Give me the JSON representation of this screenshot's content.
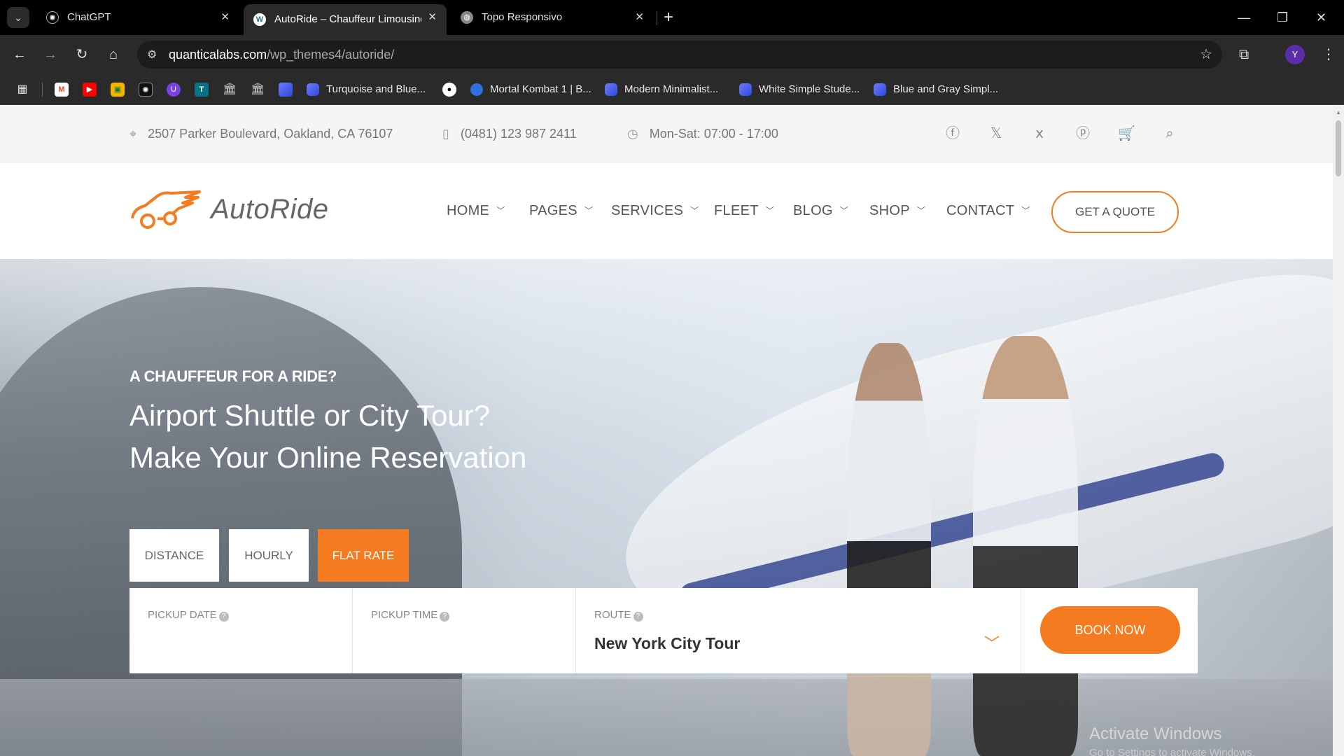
{
  "browser": {
    "tabs": [
      {
        "title": "ChatGPT",
        "icon": "chatgpt-icon"
      },
      {
        "title": "AutoRide – Chauffeur Limousine",
        "icon": "wordpress-icon"
      },
      {
        "title": "Topo Responsivo",
        "icon": "globe-icon"
      }
    ],
    "url_host": "quanticalabs.com",
    "url_path": "/wp_themes4/autoride/",
    "profile_initial": "Y",
    "bookmarks": [
      {
        "label": "Turquoise and Blue..."
      },
      {
        "label": "Mortal Kombat 1 | B..."
      },
      {
        "label": "Modern Minimalist..."
      },
      {
        "label": "White Simple Stude..."
      },
      {
        "label": "Blue and Gray Simpl..."
      }
    ]
  },
  "topinfo": {
    "address": "2507 Parker Boulevard, Oakland, CA 76107",
    "phone": "(0481) 123 987 2411",
    "hours": "Mon-Sat: 07:00 - 17:00"
  },
  "logo": {
    "text": "AutoRide"
  },
  "nav": {
    "items": [
      "HOME",
      "PAGES",
      "SERVICES",
      "FLEET",
      "BLOG",
      "SHOP",
      "CONTACT"
    ],
    "quote_label": "GET A QUOTE"
  },
  "hero": {
    "kicker": "A CHAUFFEUR FOR A RIDE?",
    "line1": "Airport Shuttle or City Tour?",
    "line2": "Make Your Online Reservation"
  },
  "booking": {
    "tabs": [
      "DISTANCE",
      "HOURLY",
      "FLAT RATE"
    ],
    "active_tab": "FLAT RATE",
    "pickup_date_label": "PICKUP DATE",
    "pickup_time_label": "PICKUP TIME",
    "route_label": "ROUTE",
    "route_value": "New York City Tour",
    "book_label": "BOOK NOW"
  },
  "watermark": {
    "title": "Activate Windows",
    "subtitle": "Go to Settings to activate Windows."
  },
  "colors": {
    "accent": "#f47b20"
  }
}
